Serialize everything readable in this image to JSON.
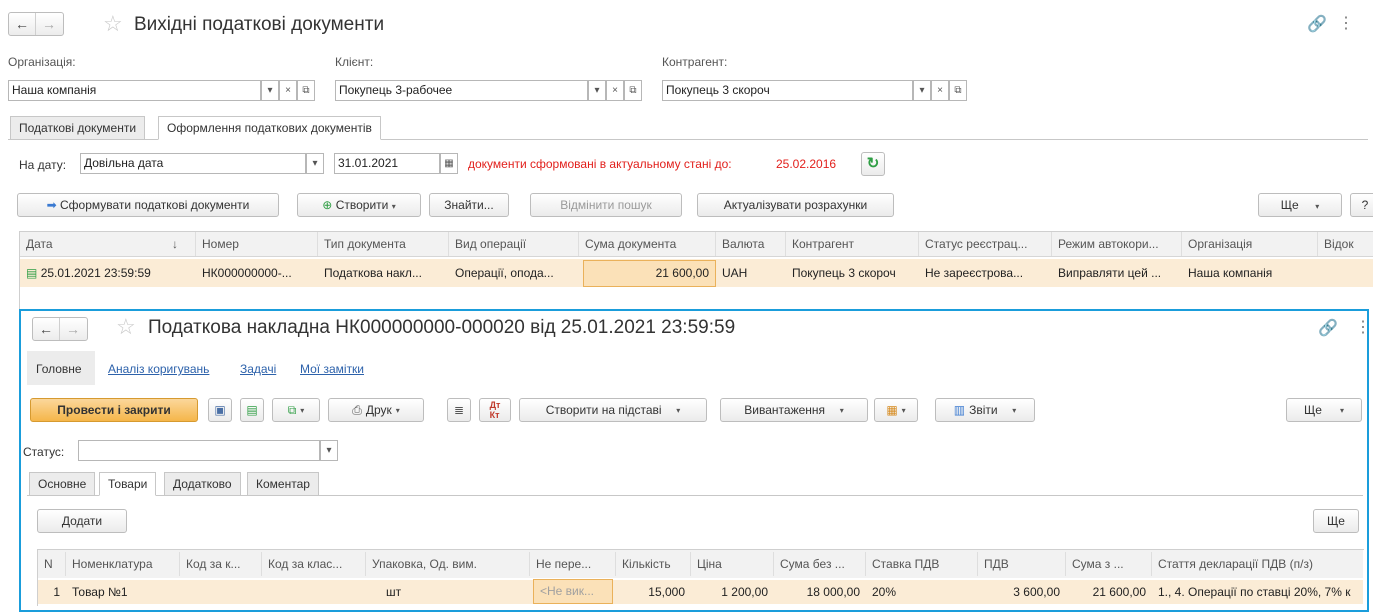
{
  "main": {
    "title": "Вихідні податкові документи",
    "org_label": "Організація:",
    "org_value": "Наша компанія",
    "client_label": "Клієнт:",
    "client_value": "Покупець 3-рабочее",
    "counterparty_label": "Контрагент:",
    "counterparty_value": "Покупець 3 скороч",
    "tabs": [
      "Податкові документи",
      "Оформлення податкових документів"
    ],
    "date_label": "На дату:",
    "date_mode": "Довільна дата",
    "date_value": "31.01.2021",
    "status_text": "документи сформовані в актуальному стані до:",
    "status_date": "25.02.2016",
    "buttons": {
      "form": "Сформувати податкові документи",
      "create": "Створити",
      "find": "Знайти...",
      "cancel_search": "Відмінити пошук",
      "update": "Актуалізувати розрахунки",
      "more": "Ще",
      "help": "?"
    },
    "columns": [
      "Дата",
      "Номер",
      "Тип документа",
      "Вид операції",
      "Сума документа",
      "Валюта",
      "Контрагент",
      "Статус реєстрац...",
      "Режим автокори...",
      "Організація",
      "Відок"
    ],
    "row": [
      "25.01.2021 23:59:59",
      "НК000000000-...",
      "Податкова накл...",
      "Операції, опода...",
      "21 600,00",
      "UAH",
      "Покупець 3 скороч",
      "Не зареєстрова...",
      "Виправляти цей ...",
      "Наша компанія",
      ""
    ]
  },
  "doc": {
    "title": "Податкова накладна НК000000000-000020 від 25.01.2021 23:59:59",
    "nav": [
      "Головне",
      "Аналіз коригувань",
      "Задачі",
      "Мої замітки"
    ],
    "buttons": {
      "post_close": "Провести і закрити",
      "print": "Друк",
      "create_based": "Створити на підставі",
      "export": "Вивантаження",
      "reports": "Звіти",
      "more": "Ще",
      "add": "Додати",
      "more2": "Ще"
    },
    "status_label": "Статус:",
    "status_value": "",
    "tabs": [
      "Основне",
      "Товари",
      "Додатково",
      "Коментар"
    ],
    "columns": [
      "N",
      "Номенклатура",
      "Код за к...",
      "Код за клас...",
      "Упаковка, Од. вим.",
      "Не пере...",
      "Кількість",
      "Ціна",
      "Сума без ...",
      "Ставка ПДВ",
      "ПДВ",
      "Сума з ...",
      "Стаття декларації ПДВ (п/з)"
    ],
    "row": [
      "1",
      "Товар №1",
      "",
      "",
      "шт",
      "<Не вик...",
      "15,000",
      "1 200,00",
      "18 000,00",
      "20%",
      "3 600,00",
      "21 600,00",
      "1., 4. Операції по ставці 20%, 7% к"
    ]
  }
}
